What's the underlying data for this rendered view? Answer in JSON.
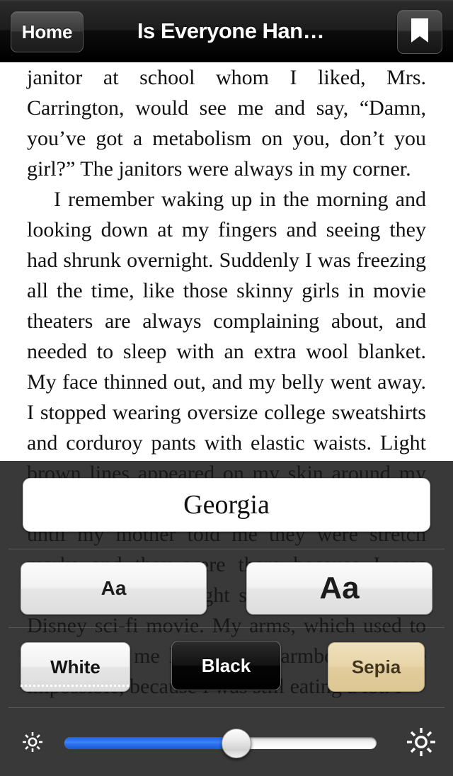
{
  "navbar": {
    "back_label": "Home",
    "title": "Is Everyone Han…",
    "bookmark_icon": "bookmark-icon"
  },
  "page": {
    "paragraphs": [
      {
        "indent": false,
        "text": "janitor at school whom I liked, Mrs. Carrington, would see me and say, “Damn, you’ve got a metabolism on you, don’t you girl?” The janitors were always in my corner."
      },
      {
        "indent": true,
        "text": "I remember waking up in the morning and looking down at my fingers and seeing they had shrunk overnight. Suddenly I was freezing all the time, like those skinny girls in movie theaters are always complaining about, and needed to sleep with an extra wool blanket. My face thinned out, and my belly went away. I stopped wearing oversize college sweatshirts and corduroy pants with elastic waists. Light brown lines appeared on my skin around my hips, and I actually thought they looked pretty, until my mother told me they were stretch marks and they were there because I was losing so much weight so fast. It was like a Disney sci-fi movie. My arms, which used to rub against me like padded armboards, were impossible, because I was still eating a lot. I"
      }
    ]
  },
  "settings": {
    "font_name": "Georgia",
    "font_size": {
      "decrease_label": "Aa",
      "increase_label": "Aa"
    },
    "themes": [
      {
        "id": "white",
        "label": "White",
        "color": "#eeeeee",
        "selected": true
      },
      {
        "id": "black",
        "label": "Black",
        "color": "#000000",
        "selected": false
      },
      {
        "id": "sepia",
        "label": "Sepia",
        "color": "#e5d3a8",
        "selected": false
      }
    ],
    "brightness": {
      "value": 55,
      "min_icon": "sun-small-icon",
      "max_icon": "sun-large-icon",
      "fill_color": "#2f74ee"
    }
  }
}
